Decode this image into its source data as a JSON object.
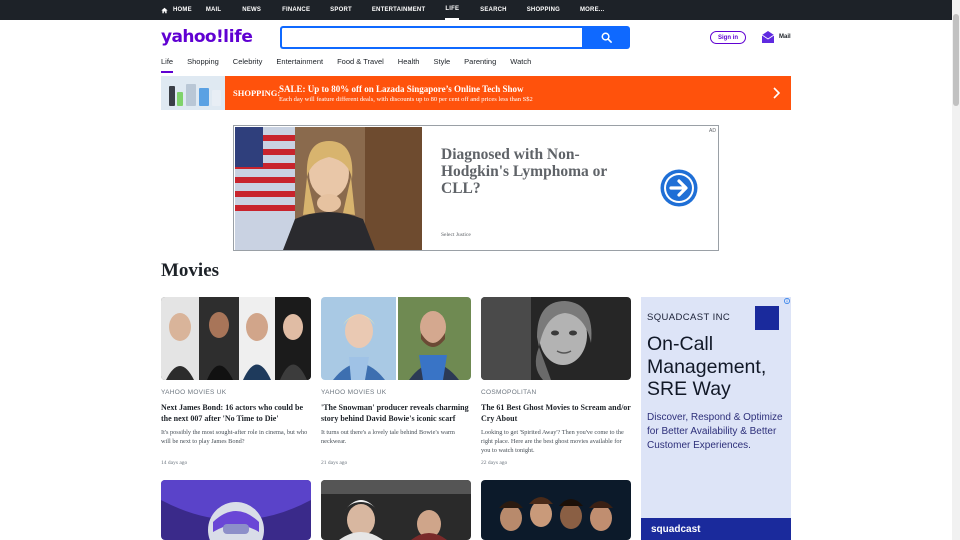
{
  "topnav": {
    "items": [
      {
        "label": "HOME"
      },
      {
        "label": "MAIL"
      },
      {
        "label": "NEWS"
      },
      {
        "label": "FINANCE"
      },
      {
        "label": "SPORT"
      },
      {
        "label": "ENTERTAINMENT"
      },
      {
        "label": "LIFE"
      },
      {
        "label": "SEARCH"
      },
      {
        "label": "SHOPPING"
      },
      {
        "label": "MORE..."
      }
    ],
    "active": "LIFE"
  },
  "header": {
    "logo_yahoo": "yahoo!",
    "logo_life": "life",
    "search_value": "",
    "sign_in": "Sign in",
    "mail": "Mail"
  },
  "subnav": {
    "tabs": [
      "Life",
      "Shopping",
      "Celebrity",
      "Entertainment",
      "Food & Travel",
      "Health",
      "Style",
      "Parenting",
      "Watch"
    ],
    "active": "Life"
  },
  "promo": {
    "kicker": "SHOPPING:",
    "headline": "SALE: Up to 80% off on Lazada Singapore’s Online Tech Show",
    "sub": "Each day will feature different deals, with discounts up to 80 per cent off and prices less than S$2"
  },
  "ad": {
    "headline": "Diagnosed with Non-Hodgkin's Lymphoma or CLL?",
    "sponsor": "Select Justice",
    "tag": "AD"
  },
  "section": {
    "title": "Movies"
  },
  "cards": [
    {
      "source": "YAHOO MOVIES UK",
      "title": "Next James Bond: 16 actors who could be the next 007 after 'No Time to Die'",
      "desc": "It's possibly the most sought-after role in cinema, but who will be next to play James Bond?",
      "age": "14 days ago"
    },
    {
      "source": "YAHOO MOVIES UK",
      "title": "'The Snowman' producer reveals charming story behind David Bowie's iconic scarf",
      "desc": "It turns out there's a lovely tale behind Bowie's warm neckwear.",
      "age": "21 days ago"
    },
    {
      "source": "COSMOPOLITAN",
      "title": "The 61 Best Ghost Movies to Scream and/or Cry About",
      "desc": "Looking to get 'Spirited Away'? Then you've come to the right place. Here are the best ghost movies available for you to watch tonight.",
      "age": "22 days ago"
    }
  ],
  "side_ad": {
    "brand": "SQUADCAST INC",
    "headline": "On-Call Management, SRE Way",
    "sub": "Discover, Respond & Optimize for Better Availability & Better Customer Experiences.",
    "footer": "squadcast"
  }
}
